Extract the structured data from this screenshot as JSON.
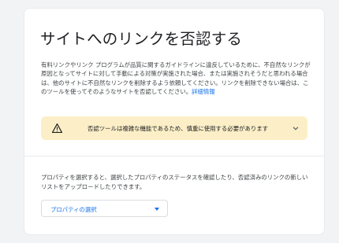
{
  "page": {
    "title": "サイトへのリンクを否認する",
    "description": "有料リンクやリンク プログラムが品質に関するガイドラインに違反しているために、不自然なリンクが原因となってサイトに対して手動による対策が実施された場合、または実施されそうだと思われる場合は、他のサイトに不自然なリンクを削除するよう依頼してください。リンクを削除できない場合は、このツールを使ってそのようなサイトを否認してください。",
    "learn_more": "詳細情報"
  },
  "warning": {
    "text": "否認ツールは複雑な機能であるため、慎重に使用する必要があります",
    "icon": "warning-triangle-icon",
    "background": "#fcefc7"
  },
  "property": {
    "description": "プロパティを選択すると、選択したプロパティのステータスを確認したり、否認済みのリンクの新しいリストをアップロードしたりできます。",
    "select_label": "プロパティの選択",
    "accent": "#1a73e8"
  }
}
